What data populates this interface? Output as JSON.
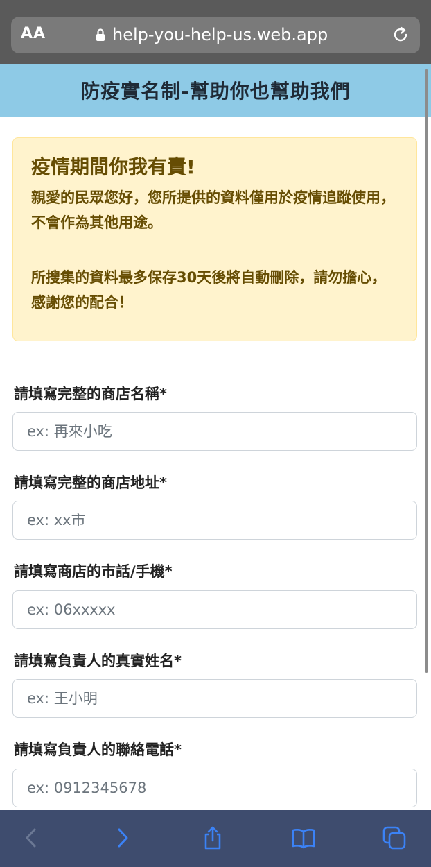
{
  "browser": {
    "text_size_label": "AA",
    "url": "help-you-help-us.web.app",
    "icons": {
      "lock": "lock-icon",
      "reload": "reload-icon",
      "back": "chevron-left-icon",
      "forward": "chevron-right-icon",
      "share": "share-icon",
      "bookmarks": "book-icon",
      "tabs": "tabs-icon"
    }
  },
  "header": {
    "title": "防疫實名制-幫助你也幫助我們"
  },
  "notice": {
    "heading": "疫情期間你我有責!",
    "paragraph1": "親愛的民眾您好，您所提供的資料僅用於疫情追蹤使用，不會作為其他用途。",
    "paragraph2": "所搜集的資料最多保存30天後將自動刪除，請勿擔心，感謝您的配合！"
  },
  "form": {
    "fields": [
      {
        "label": "請填寫完整的商店名稱*",
        "placeholder": "ex: 再來小吃",
        "value": ""
      },
      {
        "label": "請填寫完整的商店地址*",
        "placeholder": "ex: xx市",
        "value": ""
      },
      {
        "label": "請填寫商店的市話/手機*",
        "placeholder": "ex: 06xxxxx",
        "value": ""
      },
      {
        "label": "請填寫負責人的真實姓名*",
        "placeholder": "ex: 王小明",
        "value": ""
      },
      {
        "label": "請填寫負責人的聯絡電話*",
        "placeholder": "ex: 0912345678",
        "value": ""
      }
    ]
  },
  "colors": {
    "header_bg": "#8ecae6",
    "notice_bg": "#fff3cd",
    "notice_text": "#664d03",
    "toolbar_bg": "#3e4c6e",
    "toolbar_active": "#3b82f6"
  }
}
